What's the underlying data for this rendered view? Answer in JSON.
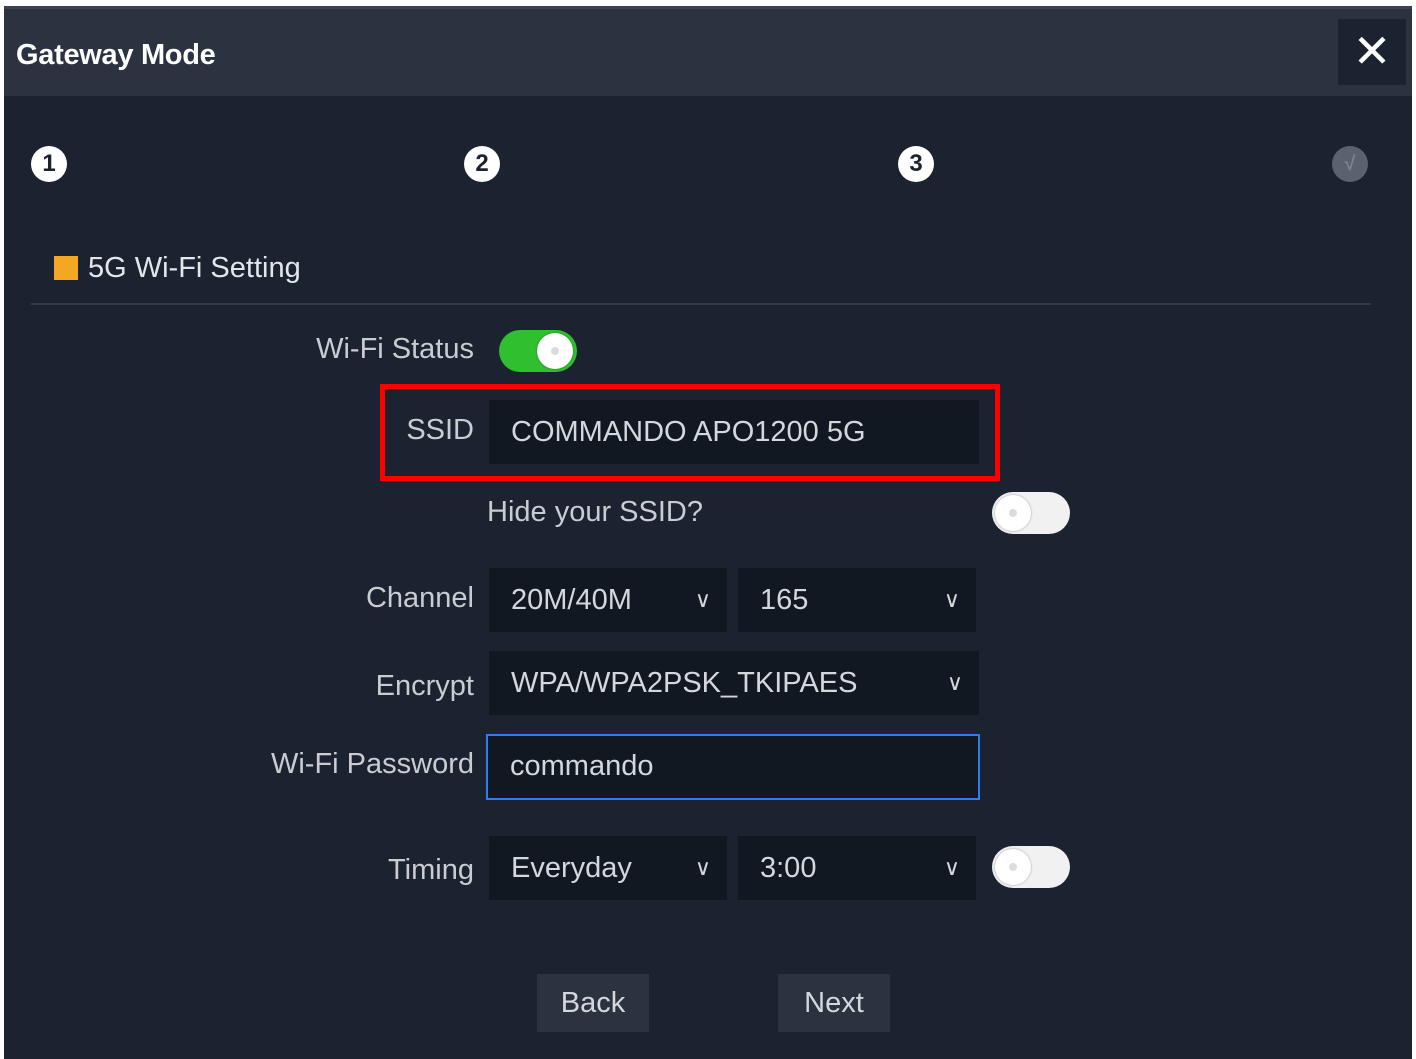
{
  "dialog": {
    "title": "Gateway Mode",
    "close_label": "✕"
  },
  "steps": [
    {
      "label": "1"
    },
    {
      "label": "2"
    },
    {
      "label": "3"
    },
    {
      "label": "√"
    }
  ],
  "section": {
    "title": "5G Wi-Fi Setting",
    "accent_color": "#f5a623"
  },
  "form": {
    "wifi_status": {
      "label": "Wi-Fi Status",
      "on": true
    },
    "ssid": {
      "label": "SSID",
      "value": "COMMANDO APO1200 5G"
    },
    "hide_ssid": {
      "label": "Hide your SSID?",
      "on": false
    },
    "channel": {
      "label": "Channel",
      "bandwidth": "20M/40M",
      "number": "165"
    },
    "encrypt": {
      "label": "Encrypt",
      "value": "WPA/WPA2PSK_TKIPAES"
    },
    "password": {
      "label": "Wi-Fi Password",
      "value": "commando"
    },
    "timing": {
      "label": "Timing",
      "day": "Everyday",
      "time": "3:00",
      "on": false
    }
  },
  "buttons": {
    "back": "Back",
    "next": "Next"
  },
  "icons": {
    "chevron": "chevron-down-icon"
  }
}
